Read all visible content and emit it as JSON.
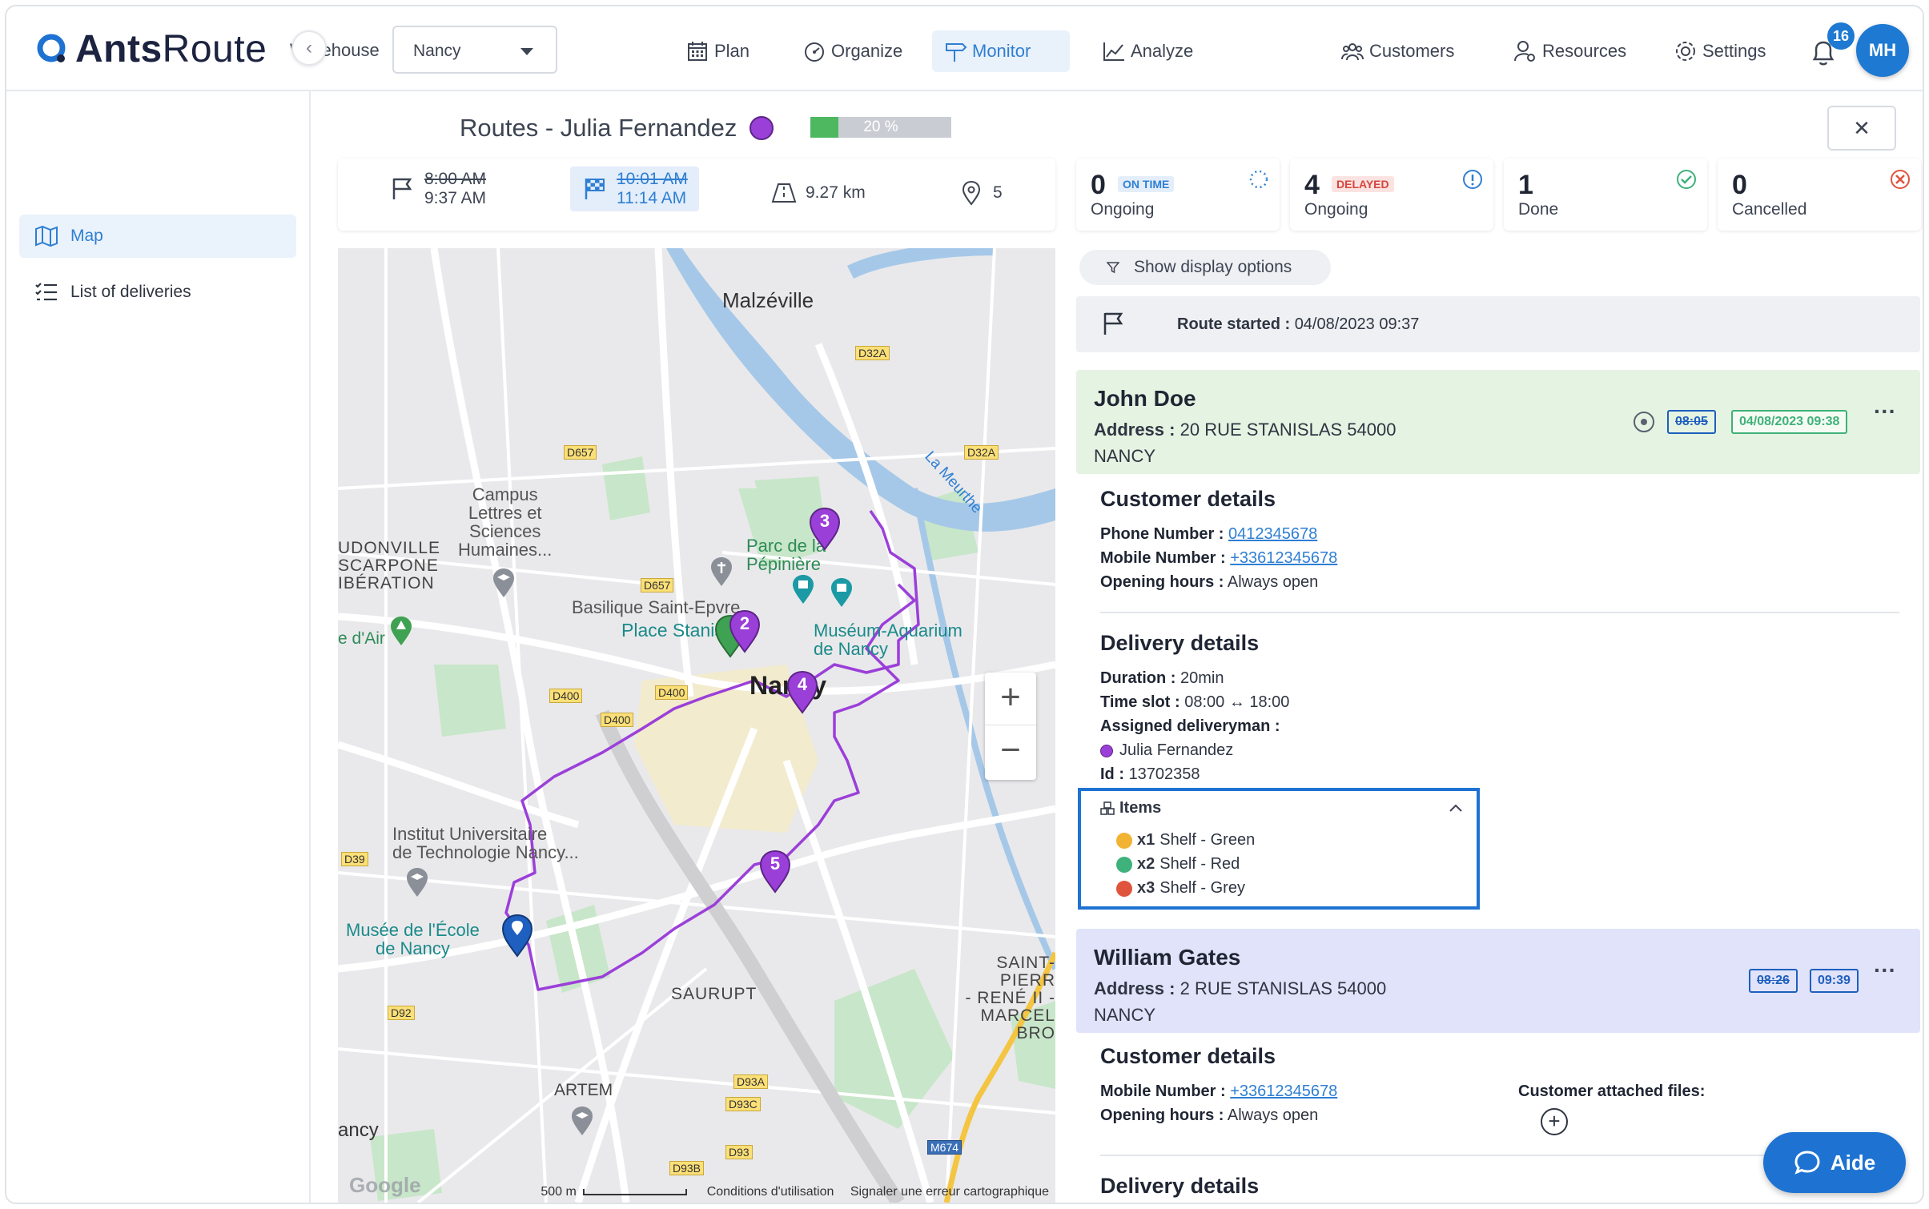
{
  "app": {
    "brand_bold": "Ants",
    "brand_thin": "Route"
  },
  "header": {
    "warehouse_label": "Warehouse",
    "warehouse_value": "Nancy",
    "nav": [
      {
        "label": "Plan",
        "icon": "calendar-icon"
      },
      {
        "label": "Organize",
        "icon": "gauge-icon"
      },
      {
        "label": "Monitor",
        "icon": "signpost-icon",
        "active": true
      },
      {
        "label": "Analyze",
        "icon": "chart-icon"
      },
      {
        "label": "Customers",
        "icon": "people-icon"
      },
      {
        "label": "Resources",
        "icon": "user-gear-icon"
      },
      {
        "label": "Settings",
        "icon": "gear-icon"
      }
    ],
    "notifications_count": "16",
    "user_initials": "MH"
  },
  "sidebar": {
    "items": [
      {
        "label": "Map",
        "icon": "map-icon",
        "active": true
      },
      {
        "label": "List of deliveries",
        "icon": "list-icon"
      }
    ]
  },
  "route": {
    "title": "Routes - Julia Fernandez",
    "color": "#9b3fd9",
    "progress_percent": 20,
    "progress_label": "20 %",
    "planned_start": "8:00 AM",
    "actual_start": "9:37 AM",
    "planned_end": "10:01 AM",
    "estimated_end": "11:14 AM",
    "distance": "9.27 km",
    "stops": "5"
  },
  "kpis": [
    {
      "value": "0",
      "tag": "ON TIME",
      "label": "Ongoing",
      "tag_color": "#2f7fd3",
      "tag_bg": "#e4eefa"
    },
    {
      "value": "4",
      "tag": "DELAYED",
      "label": "Ongoing",
      "tag_color": "#d6453d",
      "tag_bg": "#fbe3e1"
    },
    {
      "value": "1",
      "tag": "",
      "label": "Done"
    },
    {
      "value": "0",
      "tag": "",
      "label": "Cancelled"
    }
  ],
  "panel": {
    "display_options": "Show display options",
    "route_started_label": "Route started :",
    "route_started_value": "04/08/2023 09:37"
  },
  "stop1": {
    "name": "John Doe",
    "address_label": "Address :",
    "address": "20 RUE STANISLAS 54000 NANCY",
    "planned_time": "08:05",
    "actual_time": "04/08/2023 09:38",
    "customer_details_title": "Customer details",
    "phone_label": "Phone Number :",
    "phone": "0412345678",
    "mobile_label": "Mobile Number :",
    "mobile": "+33612345678",
    "hours_label": "Opening hours :",
    "hours": "Always open",
    "delivery_details_title": "Delivery details",
    "duration_label": "Duration :",
    "duration": "20min",
    "timeslot_label": "Time slot :",
    "timeslot": "08:00 ↔ 18:00",
    "deliveryman_label": "Assigned deliveryman :",
    "deliveryman": "Julia Fernandez",
    "id_label": "Id :",
    "id": "13702358",
    "items_title": "Items",
    "items": [
      {
        "qty": "x1",
        "name": "Shelf - Green",
        "status_color": "#f2b232",
        "status": "!"
      },
      {
        "qty": "x2",
        "name": "Shelf - Red",
        "status_color": "#3fb17a",
        "status": "✓"
      },
      {
        "qty": "x3",
        "name": "Shelf - Grey",
        "status_color": "#e0533d",
        "status": "×"
      }
    ]
  },
  "stop2": {
    "name": "William Gates",
    "address_label": "Address :",
    "address": "2 RUE STANISLAS 54000 NANCY",
    "planned_time": "08:26",
    "estimated_time": "09:39",
    "customer_details_title": "Customer details",
    "mobile_label": "Mobile Number :",
    "mobile": "+33612345678",
    "hours_label": "Opening hours :",
    "hours": "Always open",
    "attached_files_label": "Customer attached files:",
    "delivery_details_title": "Delivery details"
  },
  "map": {
    "labels": {
      "malzeville": "Malzéville",
      "campus": "Campus\nLettres et\nSciences\nHumaines...",
      "parc": "Parc de la\nPépinière",
      "basilique": "Basilique Saint-Epvre",
      "place": "Place Stanis",
      "museum": "Muséum-Aquarium\nde Nancy",
      "nancy": "Nancy",
      "institut": "Institut Universitaire\nde Technologie Nancy...",
      "musee": "Musée de l'École\nde Nancy",
      "saurupt": "SAURUPT",
      "artem": "ARTEM",
      "saint_pierre": "SAINT-PIERR\n- RENÉ II -\nMARCEL BRO",
      "dommartemont": "UDONVILLE\nSCARPONE\nIBÉRATION",
      "dair": "e d'Air",
      "ancy": "ancy",
      "meurthe": "La Meurthe",
      "scale": "500 m",
      "conditions": "Conditions d'utilisation",
      "report": "Signaler une erreur cartographique",
      "google": "Google"
    },
    "stops": [
      "2",
      "3",
      "4",
      "5"
    ]
  },
  "help": {
    "label": "Aide"
  }
}
